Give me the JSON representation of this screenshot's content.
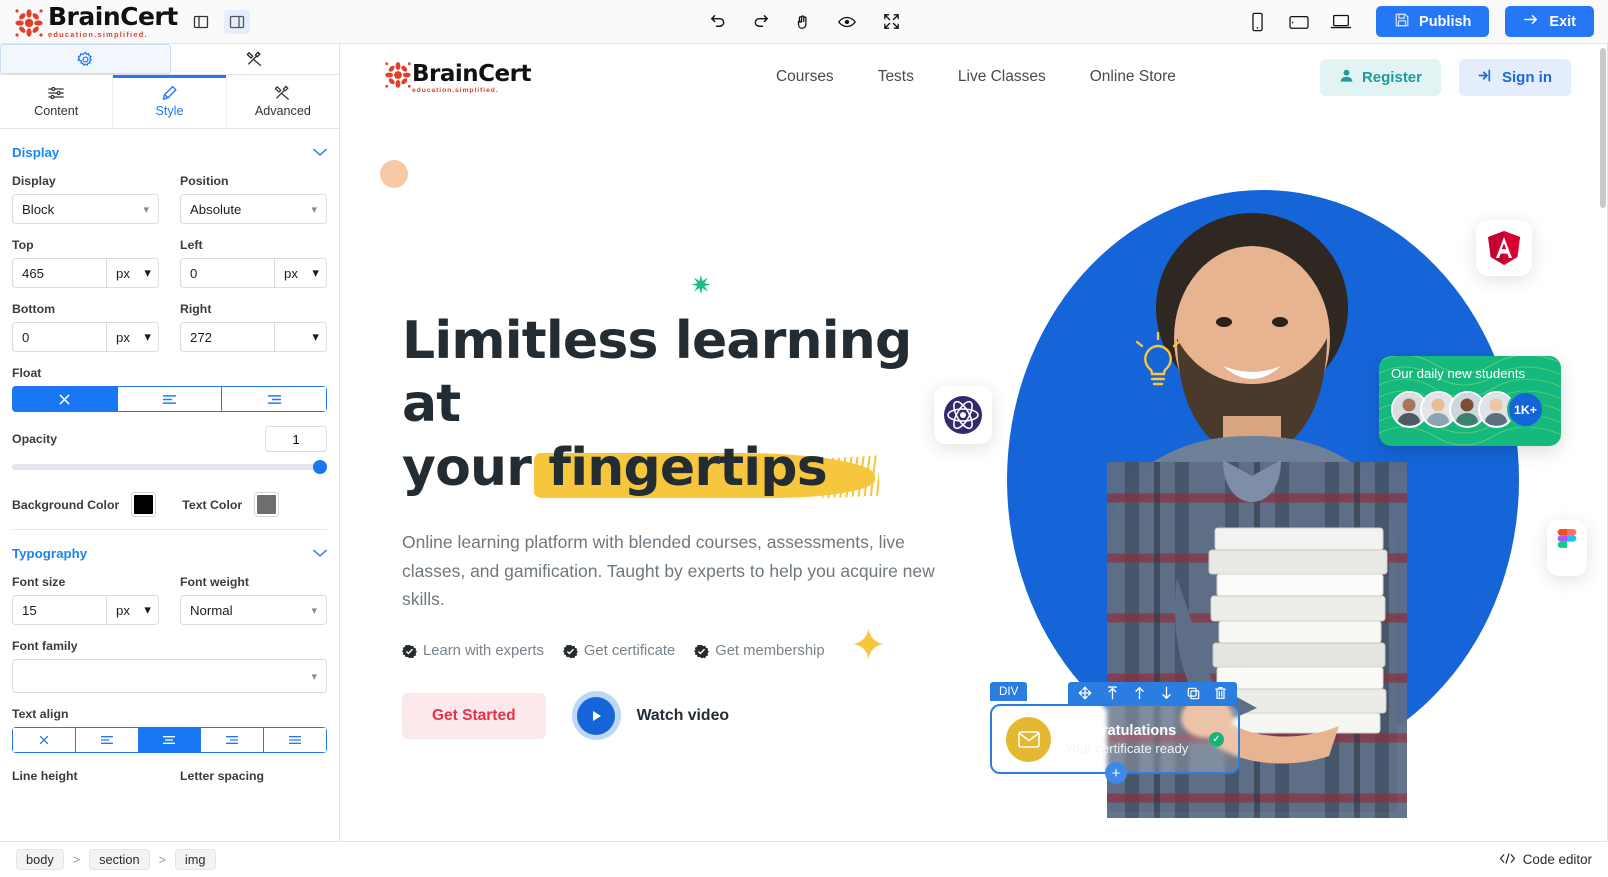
{
  "editor": {
    "brand": {
      "name": "BrainCert",
      "tagline": "education.simplified."
    },
    "layout_toggles": [
      {
        "name": "panel-left-toggle",
        "icon": "panel-left-icon",
        "active": false
      },
      {
        "name": "panel-right-toggle",
        "icon": "panel-right-icon",
        "active": true
      }
    ],
    "history": [
      {
        "label": "Undo",
        "icon": "undo-icon"
      },
      {
        "label": "Redo",
        "icon": "redo-icon"
      }
    ],
    "tools": [
      {
        "label": "Drag",
        "icon": "hand-icon"
      },
      {
        "label": "Preview",
        "icon": "eye-icon"
      },
      {
        "label": "Fullscreen",
        "icon": "fullscreen-icon"
      }
    ],
    "devices": [
      {
        "label": "Mobile",
        "icon": "mobile-icon"
      },
      {
        "label": "Tablet",
        "icon": "tablet-icon"
      },
      {
        "label": "Desktop",
        "icon": "desktop-icon"
      }
    ],
    "publish_label": "Publish",
    "exit_label": "Exit",
    "accent_blue": "#2577f5"
  },
  "sidebar": {
    "top_tabs": [
      {
        "name": "settings-tab",
        "icon": "gear-icon",
        "active": true
      },
      {
        "name": "tools-tab",
        "icon": "tools-icon",
        "active": false
      }
    ],
    "tabs": [
      {
        "label": "Content",
        "icon": "sliders-icon",
        "active": false
      },
      {
        "label": "Style",
        "icon": "brush-icon",
        "active": true
      },
      {
        "label": "Advanced",
        "icon": "tools-icon",
        "active": false
      }
    ],
    "display_section": {
      "title": "Display",
      "fields": {
        "display_label": "Display",
        "display_value": "Block",
        "position_label": "Position",
        "position_value": "Absolute",
        "top_label": "Top",
        "top_value": "465",
        "top_unit": "px",
        "left_label": "Left",
        "left_value": "0",
        "left_unit": "px",
        "bottom_label": "Bottom",
        "bottom_value": "0",
        "bottom_unit": "px",
        "right_label": "Right",
        "right_value": "272",
        "right_unit": "",
        "float_label": "Float",
        "float_options": [
          "none",
          "left",
          "right"
        ],
        "float_selected": 0,
        "opacity_label": "Opacity",
        "opacity_value": "1",
        "background_color_label": "Background Color",
        "background_color_value": "#000000",
        "text_color_label": "Text Color",
        "text_color_value": "#6e6e6e"
      }
    },
    "typography_section": {
      "title": "Typography",
      "fields": {
        "font_size_label": "Font size",
        "font_size_value": "15",
        "font_size_unit": "px",
        "font_weight_label": "Font weight",
        "font_weight_value": "Normal",
        "font_family_label": "Font family",
        "font_family_value": "",
        "text_align_label": "Text align",
        "text_align_options": [
          "none",
          "left",
          "center",
          "right",
          "justify"
        ],
        "text_align_selected": 2,
        "line_height_label": "Line height",
        "letter_spacing_label": "Letter spacing"
      }
    }
  },
  "site": {
    "brand": {
      "name": "BrainCert",
      "tagline": "education.simplified."
    },
    "nav": [
      "Courses",
      "Tests",
      "Live Classes",
      "Online Store"
    ],
    "register_label": "Register",
    "signin_label": "Sign in",
    "hero": {
      "title_line1": "Limitless learning at",
      "title_line2_pre": "your ",
      "title_highlight": "fingertips",
      "subtitle": "Online learning platform with blended courses, assessments, live classes, and gamification. Taught by experts to help you acquire new skills.",
      "features": [
        "Learn with experts",
        "Get certificate",
        "Get membership"
      ],
      "cta_primary": "Get Started",
      "cta_video": "Watch video"
    },
    "students_card": {
      "title": "Our daily new students",
      "count": "1K+"
    },
    "cert_card": {
      "title": "Congratulations",
      "subtitle": "Your certificate ready"
    },
    "chips": [
      {
        "name": "react-logo-chip"
      },
      {
        "name": "angular-logo-chip"
      },
      {
        "name": "figma-logo-chip"
      }
    ]
  },
  "selection": {
    "tag": "DIV",
    "toolbar": [
      {
        "label": "Move",
        "icon": "move-icon"
      },
      {
        "label": "Select parent",
        "icon": "arrow-up-from-line-icon"
      },
      {
        "label": "Move up",
        "icon": "arrow-up-icon"
      },
      {
        "label": "Move down",
        "icon": "arrow-down-icon"
      },
      {
        "label": "Duplicate",
        "icon": "copy-icon"
      },
      {
        "label": "Delete",
        "icon": "trash-icon"
      }
    ],
    "add_label": "+"
  },
  "bottom": {
    "breadcrumbs": [
      "body",
      "section",
      "img"
    ],
    "separator": ">",
    "code_editor_label": "Code editor"
  }
}
